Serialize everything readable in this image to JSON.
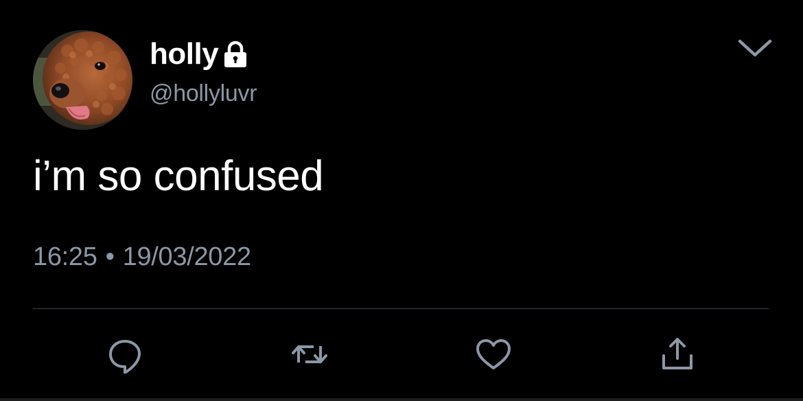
{
  "tweet": {
    "display_name": "holly",
    "handle": "@hollyluvr",
    "text": "i’m so confused",
    "time": "16:25",
    "separator": "•",
    "date": "19/03/2022",
    "protected_account_icon": "lock-icon",
    "menu_icon": "chevron-down-icon"
  },
  "actions": [
    {
      "name": "reply",
      "icon": "reply-icon"
    },
    {
      "name": "retweet",
      "icon": "retweet-icon"
    },
    {
      "name": "like",
      "icon": "heart-icon"
    },
    {
      "name": "share",
      "icon": "share-icon"
    }
  ],
  "colors": {
    "background": "#000000",
    "primary_text": "#ffffff",
    "secondary_text": "#8b98a5",
    "divider": "#38444d"
  }
}
